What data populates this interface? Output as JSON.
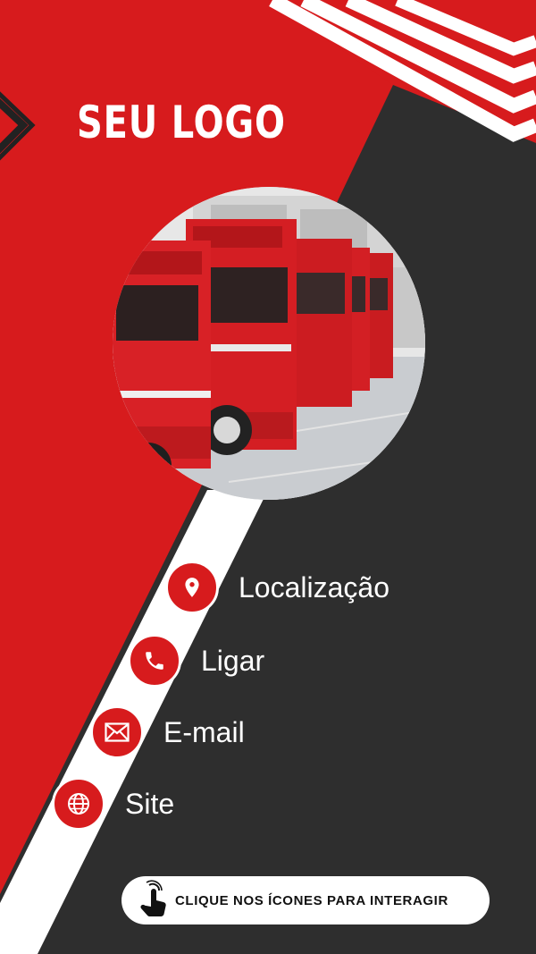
{
  "brand": {
    "logo_text": "SEU LOGO"
  },
  "colors": {
    "red": "#d71b1d",
    "dark": "#2e2e2e",
    "white": "#ffffff"
  },
  "hero_image": {
    "subject": "fleet of red trucks parked in a row"
  },
  "contact_items": [
    {
      "label": "Localização",
      "icon": "location-pin-icon"
    },
    {
      "label": "Ligar",
      "icon": "phone-icon"
    },
    {
      "label": "E-mail",
      "icon": "envelope-icon"
    },
    {
      "label": "Site",
      "icon": "globe-icon"
    }
  ],
  "cta": {
    "text": "CLIQUE NOS ÍCONES PARA INTERAGIR",
    "icon": "tap-hand-icon"
  }
}
